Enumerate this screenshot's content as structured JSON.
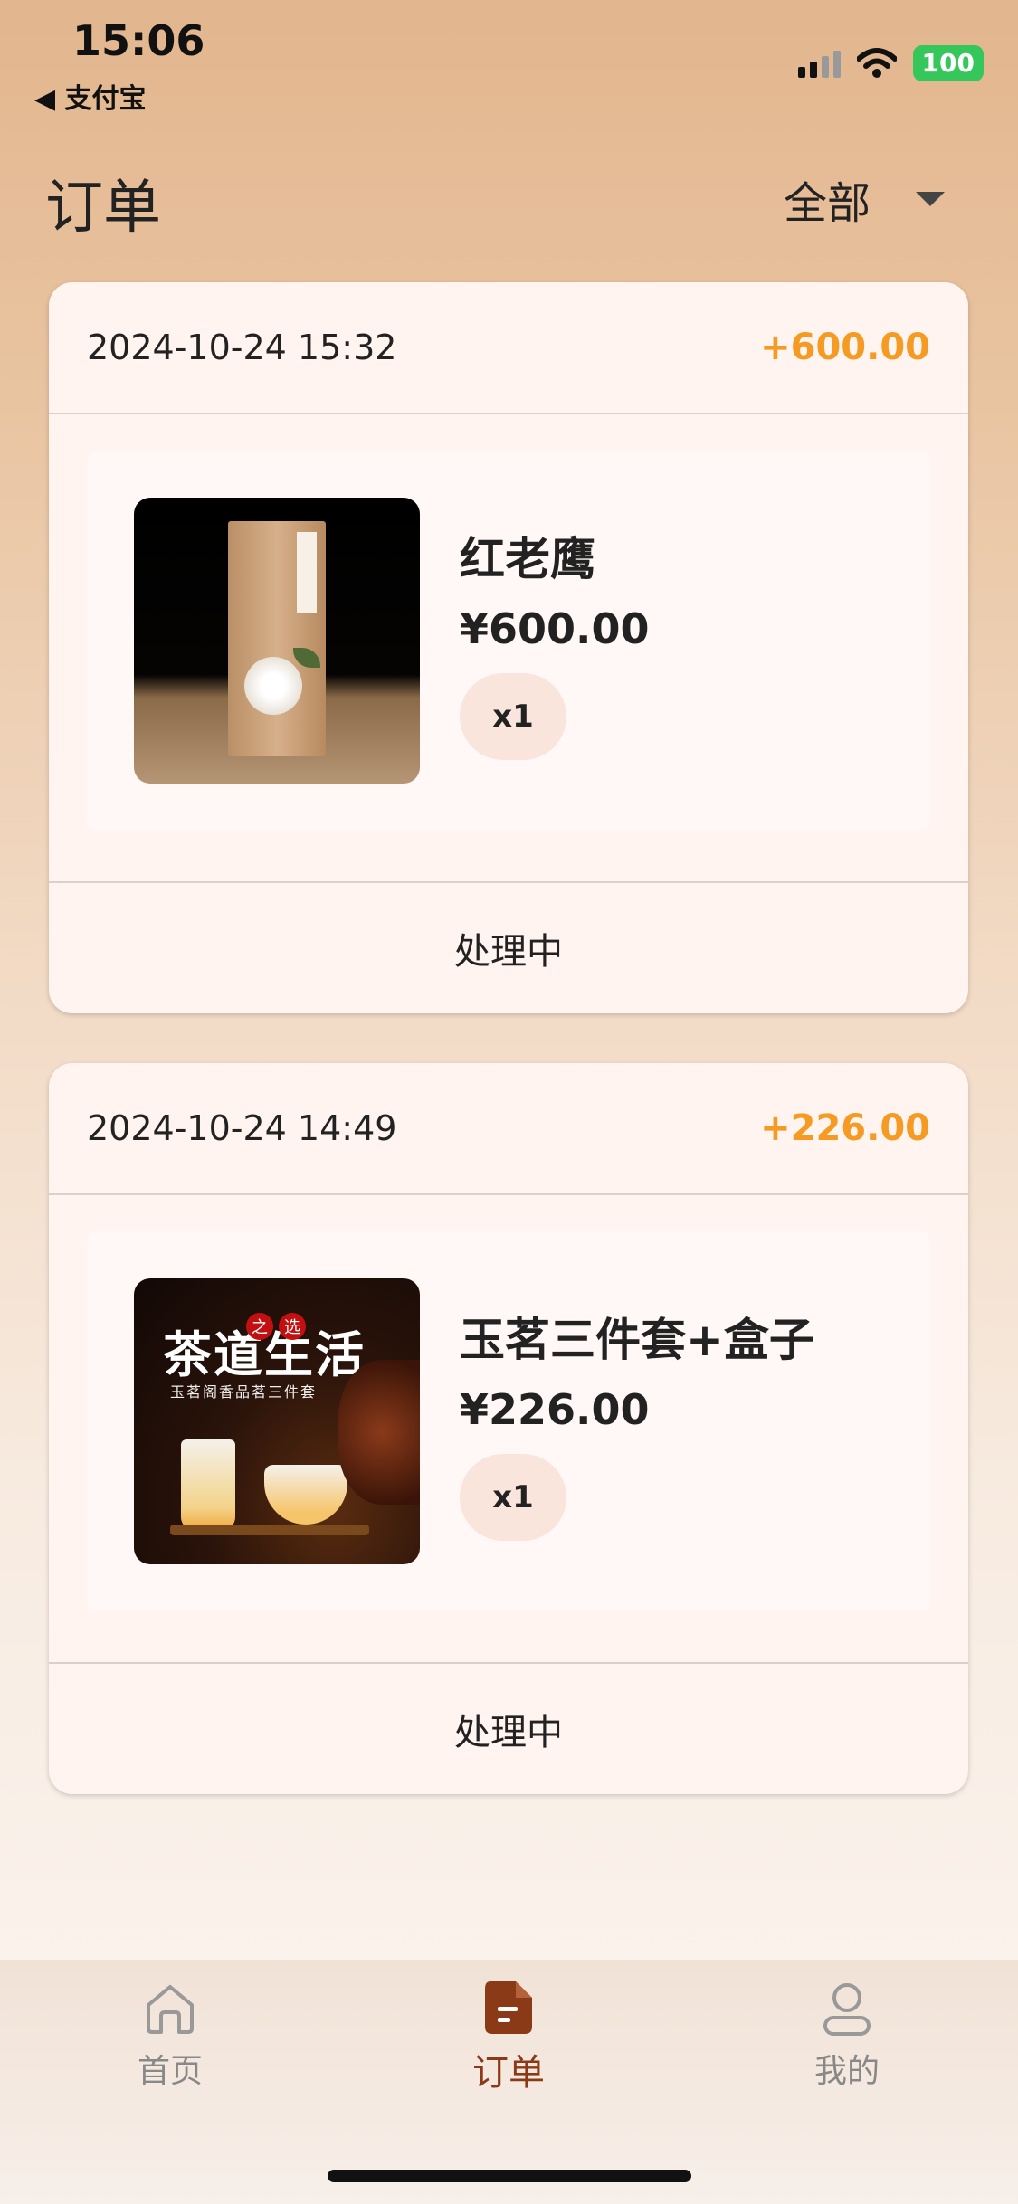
{
  "status_bar": {
    "time": "15:06",
    "back_app": "◀ 支付宝",
    "battery": "100"
  },
  "header": {
    "title": "订单",
    "filter_label": "全部"
  },
  "orders": [
    {
      "datetime": "2024-10-24 15:32",
      "total": "+600.00",
      "item_name": "红老鹰",
      "item_price": "¥600.00",
      "quantity": "x1",
      "status": "处理中"
    },
    {
      "datetime": "2024-10-24 14:49",
      "total": "+226.00",
      "item_name": "玉茗三件套+盒子",
      "item_price": "¥226.00",
      "quantity": "x1",
      "status": "处理中"
    }
  ],
  "product_art": {
    "art2_title": "茶道生活",
    "art2_seal": "之",
    "art2_seal2": "选",
    "art2_sub": "玉茗阁香品茗三件套"
  },
  "tabbar": {
    "home_label": "首页",
    "orders_label": "订单",
    "mine_label": "我的"
  },
  "colors": {
    "accent_amount": "#f59a22",
    "active_tab": "#8a3a16",
    "battery": "#35c759"
  }
}
